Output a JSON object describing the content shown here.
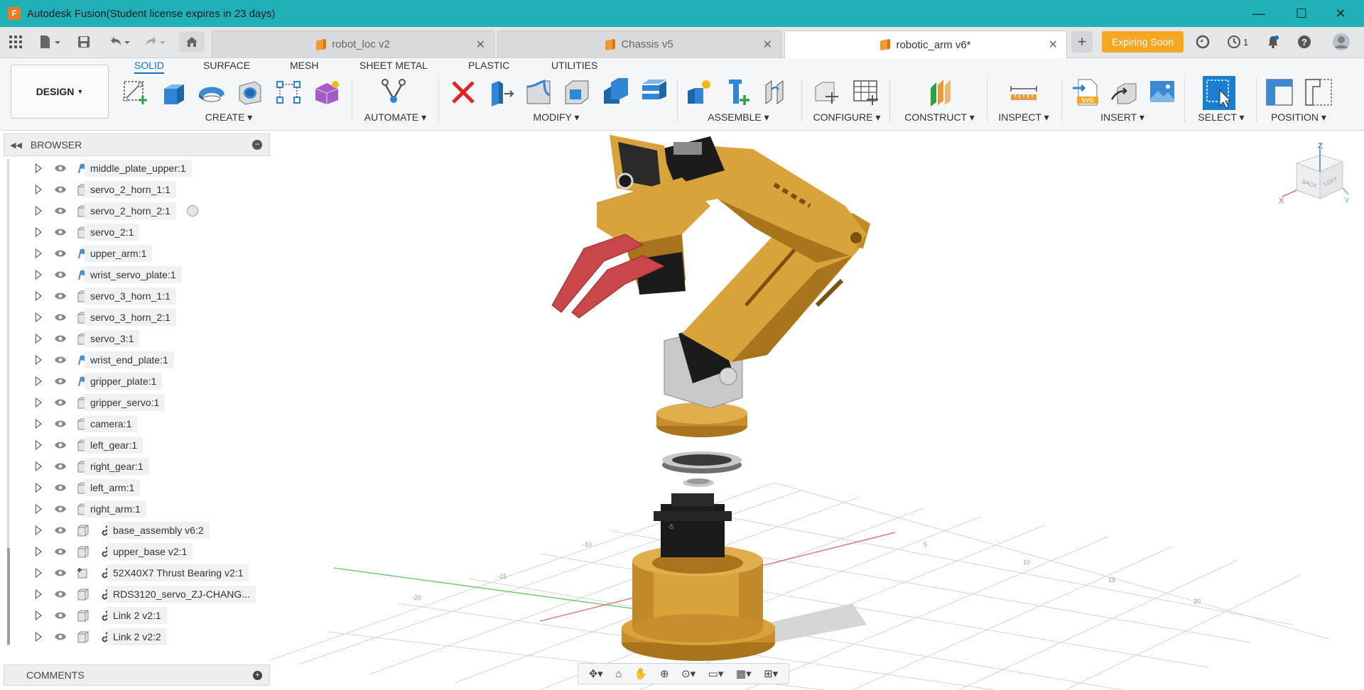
{
  "window": {
    "app_icon": "F",
    "title": "Autodesk Fusion(Student license expires in 23 days)",
    "controls": {
      "minimize": "—",
      "maximize": "☐",
      "close": "✕"
    }
  },
  "quick_access": {
    "icons": [
      "apps-grid-icon",
      "file-icon",
      "save-icon",
      "undo-icon",
      "redo-icon",
      "home-icon"
    ]
  },
  "tabs": [
    {
      "label": "robot_loc v2",
      "active": false
    },
    {
      "label": "Chassis v5",
      "active": false
    },
    {
      "label": "robotic_arm v6*",
      "active": true
    }
  ],
  "tabbar_right": {
    "new_tab": "+",
    "expiring_label": "Expiring Soon",
    "job_count": "1"
  },
  "ribbon": {
    "workspace": "DESIGN",
    "workspace_tabs": [
      "SOLID",
      "SURFACE",
      "MESH",
      "SHEET METAL",
      "PLASTIC",
      "UTILITIES"
    ],
    "active_tab": "SOLID",
    "groups": {
      "create": "CREATE",
      "automate": "AUTOMATE",
      "modify": "MODIFY",
      "assemble": "ASSEMBLE",
      "configure": "CONFIGURE",
      "construct": "CONSTRUCT",
      "inspect": "INSPECT",
      "insert": "INSERT",
      "select": "SELECT",
      "position": "POSITION"
    },
    "accent_color": "#0a74c4"
  },
  "browser": {
    "title": "BROWSER",
    "items": [
      {
        "label": "middle_plate_upper:1",
        "icon": "sketch-flag-icon",
        "linked": false
      },
      {
        "label": "servo_2_horn_1:1",
        "icon": "component-icon",
        "linked": false
      },
      {
        "label": "servo_2_horn_2:1",
        "icon": "component-icon",
        "linked": false,
        "has_indicator": true
      },
      {
        "label": "servo_2:1",
        "icon": "component-icon",
        "linked": false
      },
      {
        "label": "upper_arm:1",
        "icon": "sketch-flag-icon",
        "linked": false
      },
      {
        "label": "wrist_servo_plate:1",
        "icon": "sketch-flag-icon",
        "linked": false
      },
      {
        "label": "servo_3_horn_1:1",
        "icon": "component-icon",
        "linked": false
      },
      {
        "label": "servo_3_horn_2:1",
        "icon": "component-icon",
        "linked": false
      },
      {
        "label": "servo_3:1",
        "icon": "component-icon",
        "linked": false
      },
      {
        "label": "wrist_end_plate:1",
        "icon": "sketch-flag-icon",
        "linked": false
      },
      {
        "label": "gripper_plate:1",
        "icon": "sketch-flag-icon",
        "linked": false
      },
      {
        "label": "gripper_servo:1",
        "icon": "component-icon",
        "linked": false
      },
      {
        "label": "camera:1",
        "icon": "component-icon",
        "linked": false
      },
      {
        "label": "left_gear:1",
        "icon": "component-icon",
        "linked": false
      },
      {
        "label": "right_gear:1",
        "icon": "component-icon",
        "linked": false
      },
      {
        "label": "left_arm:1",
        "icon": "component-icon",
        "linked": false
      },
      {
        "label": "right_arm:1",
        "icon": "component-icon",
        "linked": false
      },
      {
        "label": "base_assembly v6:2",
        "icon": "component-icon",
        "linked": true
      },
      {
        "label": "upper_base v2:1",
        "icon": "component-icon",
        "linked": true
      },
      {
        "label": "52X40X7 Thrust Bearing v2:1",
        "icon": "component-joint-icon",
        "linked": true
      },
      {
        "label": "RDS3120_servo_ZJ-CHANG...",
        "icon": "component-icon",
        "linked": true
      },
      {
        "label": "Link 2 v2:1",
        "icon": "component-icon",
        "linked": true
      },
      {
        "label": "Link 2 v2:2",
        "icon": "component-icon",
        "linked": true
      }
    ]
  },
  "comments": {
    "title": "COMMENTS"
  },
  "viewcube": {
    "top": "Z",
    "front": "BACK",
    "side": "LEFT",
    "x_axis": "X",
    "y_axis": "Y"
  },
  "model_colors": {
    "body": "#d9a33c",
    "body_dark": "#a8741c",
    "gripper": "#c9474a",
    "servo": "#1b1b1b",
    "bracket": "#c8c8c8"
  }
}
